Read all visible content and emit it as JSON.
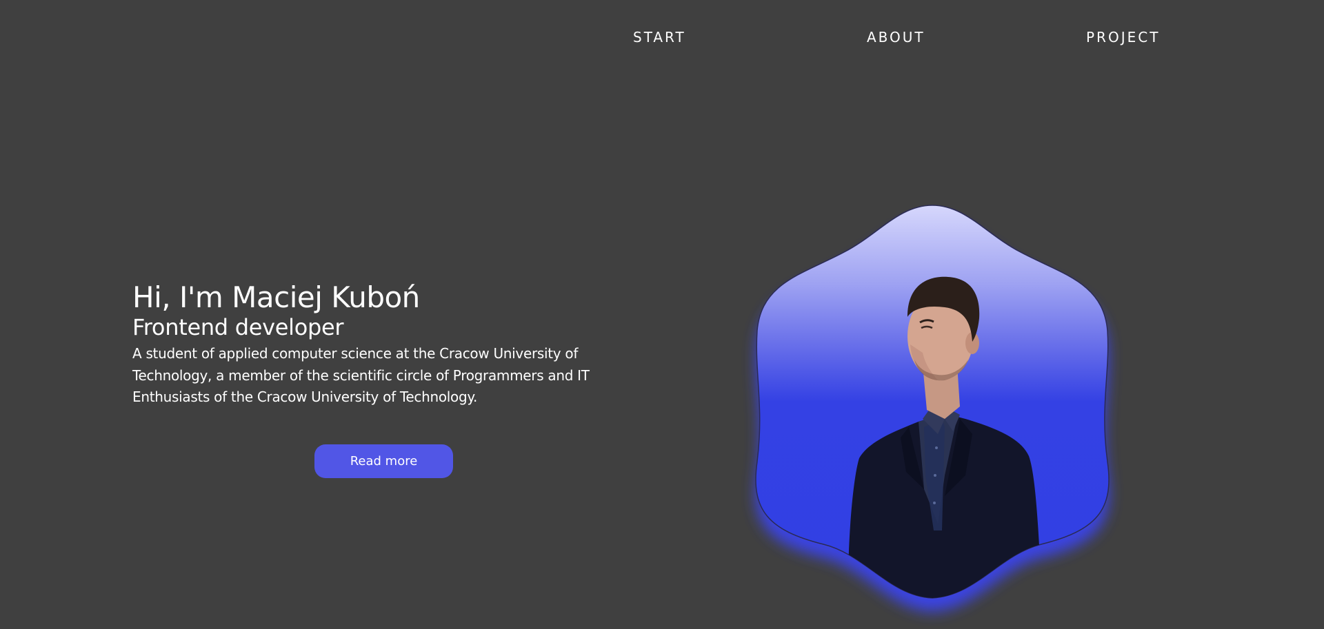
{
  "nav": {
    "items": [
      {
        "label": "START"
      },
      {
        "label": "ABOUT"
      },
      {
        "label": "PROJECT"
      }
    ]
  },
  "hero": {
    "title": "Hi, I'm Maciej Kuboń",
    "subtitle": "Frontend developer",
    "description": "A student of applied computer science at the Cracow University of Technology, a member of the scientific circle of Programmers and IT Enthusiasts of the Cracow University of Technology.",
    "button_label": "Read more"
  },
  "colors": {
    "background": "#404040",
    "accent": "#5156e6",
    "blob_top": "#d2d3fb",
    "blob_bottom": "#3140e3"
  }
}
